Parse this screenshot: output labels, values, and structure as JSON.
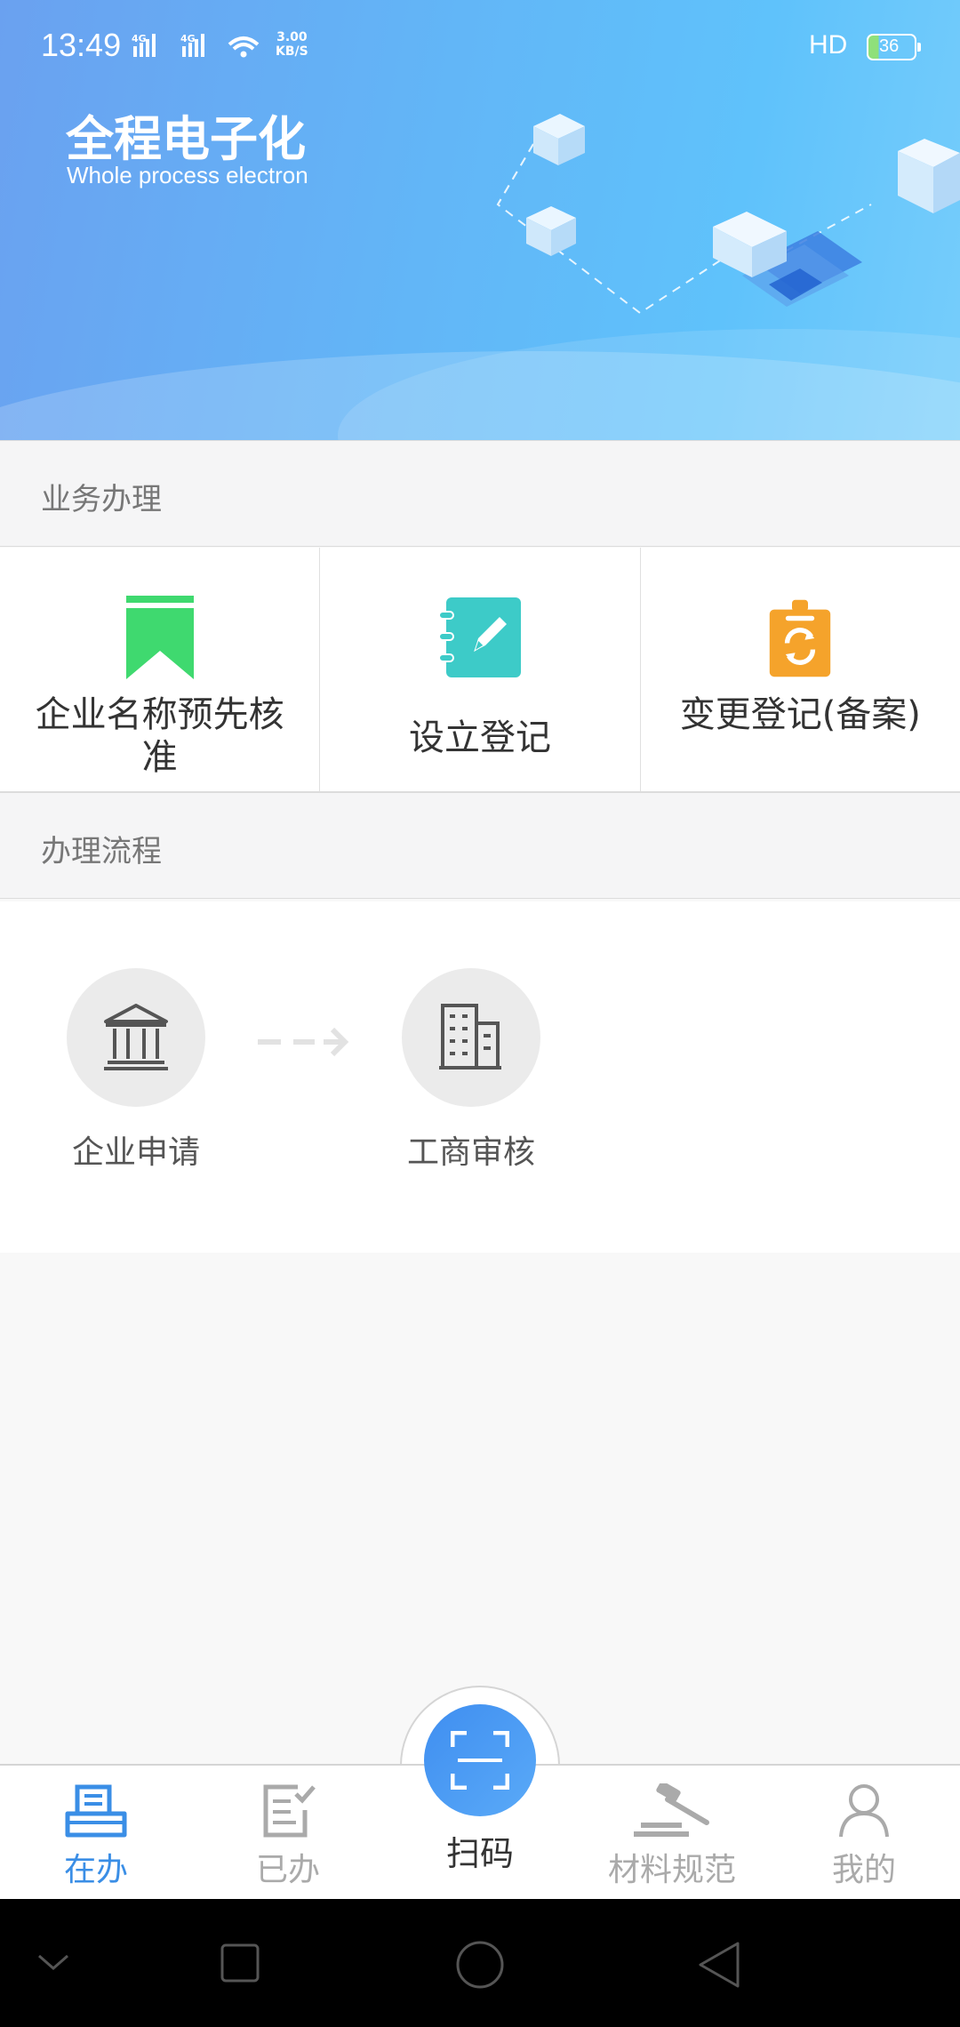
{
  "status_bar": {
    "time": "13:49",
    "network": "4G 4G",
    "speed_value": "3.00",
    "speed_unit": "KB/S",
    "hd": "HD",
    "battery": "36"
  },
  "banner": {
    "title": "全程电子化",
    "subtitle": "Whole process electron"
  },
  "business": {
    "header": "业务办理",
    "items": [
      {
        "label": "企业名称预先核准",
        "icon": "bookmark-icon",
        "color": "#3fd96f"
      },
      {
        "label": "设立登记",
        "icon": "notebook-edit-icon",
        "color": "#3dcbc8"
      },
      {
        "label": "变更登记(备案)",
        "icon": "clipboard-refresh-icon",
        "color": "#f5a32b"
      }
    ]
  },
  "process": {
    "header": "办理流程",
    "steps": [
      {
        "label": "企业申请",
        "icon": "bank-icon"
      },
      {
        "label": "工商审核",
        "icon": "building-icon"
      }
    ]
  },
  "bottom_nav": {
    "items": [
      {
        "label": "在办",
        "icon": "tray-list-icon",
        "active": true
      },
      {
        "label": "已办",
        "icon": "document-check-icon",
        "active": false
      },
      {
        "label": "扫码",
        "icon": "scan-icon",
        "active": false
      },
      {
        "label": "材料规范",
        "icon": "gavel-icon",
        "active": false
      },
      {
        "label": "我的",
        "icon": "user-icon",
        "active": false
      }
    ],
    "accent_color": "#3a8ee6"
  }
}
